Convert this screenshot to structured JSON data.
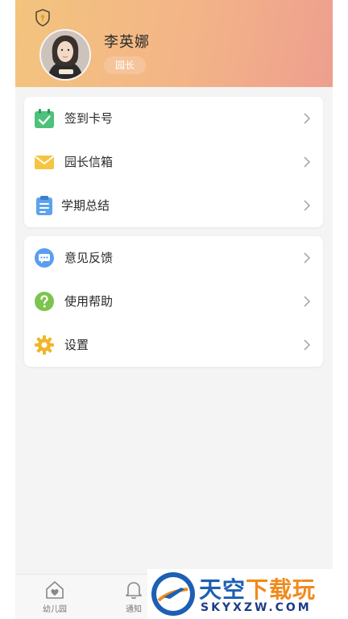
{
  "profile": {
    "name": "李英娜",
    "role": "园长"
  },
  "menu_group_1": [
    {
      "label": "签到卡号",
      "icon": "calendar-check-icon"
    },
    {
      "label": "园长信箱",
      "icon": "envelope-icon"
    },
    {
      "label": "学期总结",
      "icon": "clipboard-icon"
    }
  ],
  "menu_group_2": [
    {
      "label": "意见反馈",
      "icon": "chat-bubble-icon"
    },
    {
      "label": "使用帮助",
      "icon": "help-icon"
    },
    {
      "label": "设置",
      "icon": "gear-icon"
    }
  ],
  "tabbar": {
    "tabs": [
      {
        "label": "幼儿园",
        "icon": "home-heart-icon"
      },
      {
        "label": "通知",
        "icon": "bell-icon"
      }
    ]
  },
  "watermark": {
    "text_blue": "天空",
    "text_orange": "下载玩",
    "domain": "SKYXZW.COM"
  },
  "colors": {
    "header_start": "#f3c47e",
    "header_end": "#ee9f8f",
    "badge": "#f6c49a",
    "background": "#f4f4f4"
  }
}
